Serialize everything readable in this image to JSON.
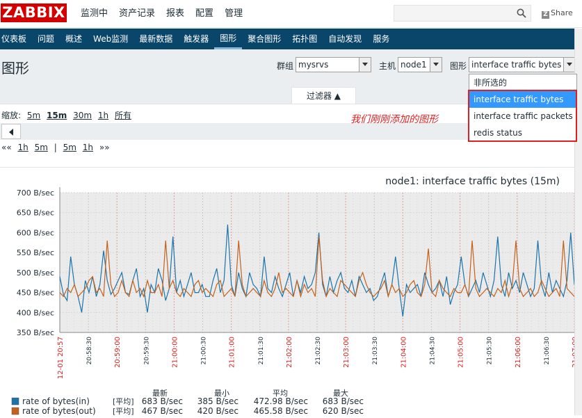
{
  "logo": "ZABBIX",
  "main_menu": [
    "监测中",
    "资产记录",
    "报表",
    "配置",
    "管理"
  ],
  "share_label": "Share",
  "sub_menu": [
    "仪表板",
    "问题",
    "概述",
    "Web监测",
    "最新数据",
    "触发器",
    "图形",
    "聚合图形",
    "拓扑图",
    "自动发现",
    "服务"
  ],
  "page_title": "图形",
  "controls": {
    "group_label": "群组",
    "group_value": "mysrvs",
    "host_label": "主机",
    "host_value": "node1",
    "graph_label": "图形",
    "graph_value": "interface traffic bytes"
  },
  "dropdown_options": [
    "非所选的",
    "interface traffic bytes",
    "interface traffic packets",
    "redis status"
  ],
  "annotation": "我们刚刚添加的图形",
  "filter_label": "过滤器 ▲",
  "zoom": {
    "label": "缩放:",
    "options": [
      "5m",
      "15m",
      "30m",
      "1h",
      "所有"
    ]
  },
  "nav": {
    "back2": "««",
    "l1h": "1h",
    "l5m": "5m",
    "sep": "|",
    "r5m": "5m",
    "r1h": "1h",
    "fwd2": "»»"
  },
  "colors": {
    "series_in": "#1a74a9",
    "series_out": "#c3611c",
    "red_label": "#e02020",
    "grid_bg": "#ebebeb"
  },
  "chart_data": {
    "type": "line",
    "title": "node1: interface traffic bytes (15m)",
    "ylim": [
      350,
      700
    ],
    "yticks": [
      "700 B/sec",
      "650 B/sec",
      "600 B/sec",
      "550 B/sec",
      "500 B/sec",
      "450 B/sec",
      "400 B/sec",
      "350 B/sec"
    ],
    "xticks": [
      {
        "label": "12-01 20:57",
        "red": true
      },
      {
        "label": "20:58:30",
        "red": false
      },
      {
        "label": "20:59:00",
        "red": true
      },
      {
        "label": "20:59:30",
        "red": false
      },
      {
        "label": "21:00:00",
        "red": true
      },
      {
        "label": "21:00:30",
        "red": false
      },
      {
        "label": "21:01:00",
        "red": true
      },
      {
        "label": "21:01:30",
        "red": false
      },
      {
        "label": "21:02:00",
        "red": true
      },
      {
        "label": "21:02:30",
        "red": false
      },
      {
        "label": "21:03:00",
        "red": true
      },
      {
        "label": "21:03:30",
        "red": false
      },
      {
        "label": "21:04:00",
        "red": true
      },
      {
        "label": "21:04:30",
        "red": false
      },
      {
        "label": "21:05:00",
        "red": true
      },
      {
        "label": "21:05:30",
        "red": false
      },
      {
        "label": "21:06:00",
        "red": true
      },
      {
        "label": "21:06:30",
        "red": false
      },
      {
        "label": "21:07:00",
        "red": true
      }
    ],
    "series": [
      {
        "name": "rate of bytes(in)",
        "values": [
          490,
          445,
          430,
          540,
          470,
          440,
          400,
          480,
          450,
          490,
          440,
          470,
          555,
          480,
          445,
          460,
          480,
          500,
          450,
          445,
          480,
          510,
          440,
          460,
          400,
          470,
          450,
          510,
          480,
          430,
          460,
          590,
          450,
          480,
          440,
          470,
          500,
          450,
          450,
          470,
          440,
          440,
          480,
          510,
          450,
          480,
          620,
          470,
          440,
          500,
          460,
          440,
          500,
          470,
          460,
          440,
          540,
          460,
          450,
          490,
          460,
          440,
          470,
          500,
          440,
          480,
          450,
          490,
          460,
          470,
          500,
          600,
          470,
          440,
          490,
          450,
          480,
          500,
          460,
          450,
          480,
          440,
          490,
          470,
          450,
          460,
          430,
          440,
          470,
          500,
          440,
          470,
          540,
          460,
          390,
          470,
          450,
          460,
          470,
          440,
          500,
          470,
          450,
          460,
          480,
          440,
          490,
          420,
          450,
          470,
          540,
          470,
          440,
          460,
          480,
          450,
          500,
          470,
          440,
          480,
          590,
          470,
          440,
          500,
          460,
          480,
          450,
          500,
          470,
          440,
          460,
          580,
          470,
          440,
          500,
          450,
          480,
          460,
          440,
          480,
          600,
          470
        ]
      },
      {
        "name": "rate of bytes(out)",
        "values": [
          450,
          440,
          460,
          450,
          470,
          440,
          450,
          460,
          480,
          490,
          450,
          460,
          440,
          580,
          470,
          440,
          450,
          480,
          450,
          440,
          480,
          450,
          460,
          440,
          480,
          450,
          450,
          470,
          440,
          580,
          460,
          480,
          450,
          440,
          460,
          450,
          440,
          470,
          480,
          450,
          460,
          450,
          440,
          470,
          480,
          440,
          450,
          460,
          440,
          580,
          470,
          440,
          450,
          460,
          450,
          440,
          480,
          450,
          440,
          460,
          500,
          450,
          460,
          450,
          440,
          480,
          440,
          470,
          450,
          460,
          440,
          590,
          480,
          440,
          460,
          450,
          440,
          480,
          470,
          460,
          450,
          440,
          480,
          500,
          470,
          450,
          440,
          450,
          460,
          480,
          440,
          470,
          450,
          460,
          440,
          450,
          470,
          480,
          450,
          440,
          470,
          560,
          450,
          440,
          480,
          460,
          450,
          440,
          460,
          450,
          450,
          470,
          440,
          580,
          460,
          440,
          450,
          460,
          450,
          440,
          460,
          450,
          480,
          440,
          470,
          580,
          460,
          440,
          450,
          460,
          440,
          450,
          480,
          460,
          440,
          450,
          460,
          440,
          580,
          460,
          450,
          440
        ]
      }
    ],
    "legend": {
      "headers": [
        "最新",
        "最小",
        "平均",
        "最大"
      ],
      "func": "[平均]",
      "rows": [
        {
          "name": "rate of bytes(in)",
          "func": "[平均]",
          "last": "683 B/sec",
          "min": "385 B/sec",
          "avg": "472.98 B/sec",
          "max": "683 B/sec"
        },
        {
          "name": "rate of bytes(out)",
          "func": "[平均]",
          "last": "467 B/sec",
          "min": "420 B/sec",
          "avg": "465.58 B/sec",
          "max": "620 B/sec"
        }
      ]
    }
  }
}
